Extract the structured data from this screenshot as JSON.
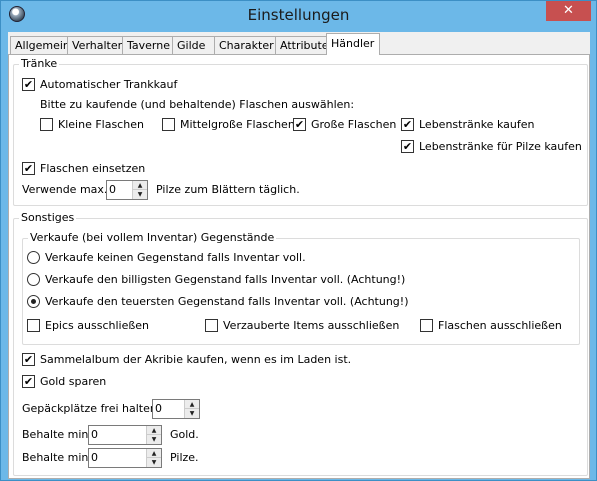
{
  "window": {
    "title": "Einstellungen",
    "close": "✕"
  },
  "tabs": [
    "Allgemein",
    "Verhalten",
    "Taverne",
    "Gilde",
    "Charakter",
    "Attribute",
    "Händler"
  ],
  "traenke": {
    "legend": "Tränke",
    "auto_kauf": {
      "label": "Automatischer Trankkauf",
      "checked": true
    },
    "prompt": "Bitte zu kaufende (und behaltende) Flaschen auswählen:",
    "kleine": {
      "label": "Kleine Flaschen",
      "checked": false
    },
    "mittel": {
      "label": "Mittelgroße Flaschen",
      "checked": false
    },
    "grosse": {
      "label": "Große Flaschen",
      "checked": true
    },
    "leben": {
      "label": "Lebenstränke kaufen",
      "checked": true
    },
    "leben_pilze": {
      "label": "Lebenstränke für Pilze kaufen",
      "checked": true
    },
    "einsetzen": {
      "label": "Flaschen einsetzen",
      "checked": true
    },
    "verwende_label": "Verwende max.",
    "verwende_value": "0",
    "verwende_suffix": "Pilze zum Blättern täglich."
  },
  "sonstiges": {
    "legend": "Sonstiges",
    "verkaufe": {
      "legend": "Verkaufe (bei vollem Inventar) Gegenstände",
      "opt1": {
        "label": "Verkaufe keinen Gegenstand falls Inventar voll.",
        "selected": false
      },
      "opt2": {
        "label": "Verkaufe den billigsten Gegenstand falls Inventar voll. (Achtung!)",
        "selected": false
      },
      "opt3": {
        "label": "Verkaufe den teuersten Gegenstand falls Inventar voll. (Achtung!)",
        "selected": true
      },
      "epics": {
        "label": "Epics ausschließen",
        "checked": false
      },
      "verzaubert": {
        "label": "Verzauberte Items ausschließen",
        "checked": false
      },
      "flaschen": {
        "label": "Flaschen ausschließen",
        "checked": false
      }
    },
    "sammelalbum": {
      "label": "Sammelalbum der Akribie kaufen, wenn es im Laden ist.",
      "checked": true
    },
    "gold_sparen": {
      "label": "Gold sparen",
      "checked": true
    },
    "gepaeck_label": "Gepäckplätze frei halten:",
    "gepaeck_value": "0",
    "behalte_gold_label": "Behalte min.",
    "behalte_gold_value": "0",
    "behalte_gold_suffix": "Gold.",
    "behalte_pilze_label": "Behalte min.",
    "behalte_pilze_value": "0",
    "behalte_pilze_suffix": "Pilze."
  },
  "icons": {
    "check": "✔",
    "up": "▲",
    "down": "▼"
  },
  "colors": {
    "titlebar": "#6cb8e8",
    "close": "#c75050",
    "panel": "#ffffff"
  }
}
